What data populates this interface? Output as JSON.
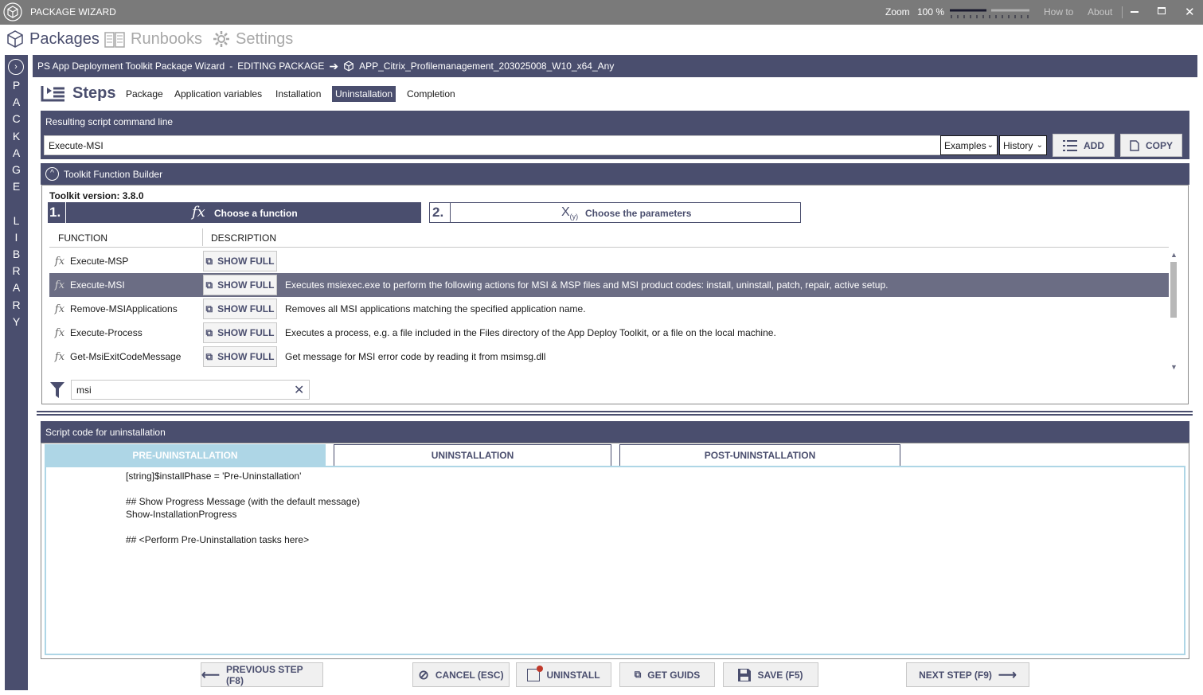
{
  "titlebar": {
    "app_title": "PACKAGE WIZARD",
    "zoom_label": "Zoom",
    "zoom_value": "100 %",
    "how_to": "How to",
    "about": "About"
  },
  "nav": {
    "packages": "Packages",
    "runbooks": "Runbooks",
    "settings": "Settings"
  },
  "sidebar": {
    "letters": [
      "P",
      "A",
      "C",
      "K",
      "A",
      "G",
      "E",
      "",
      "L",
      "I",
      "B",
      "R",
      "A",
      "R",
      "Y"
    ]
  },
  "header": {
    "wizard_title": "PS App Deployment Toolkit Package Wizard",
    "separator": "-",
    "editing_label": "EDITING PACKAGE",
    "package_name": "APP_Citrix_Profilemanagement_203025008_W10_x64_Any"
  },
  "steps": {
    "title": "Steps",
    "tabs": [
      {
        "label": "Package"
      },
      {
        "label": "Application variables"
      },
      {
        "label": "Installation"
      },
      {
        "label": "Uninstallation"
      },
      {
        "label": "Completion"
      }
    ],
    "active_tab": "Uninstallation"
  },
  "command": {
    "section_title": "Resulting script command line",
    "value": "Execute-MSI",
    "examples": "Examples",
    "history": "History",
    "add": "ADD",
    "copy": "COPY"
  },
  "builder": {
    "title": "Toolkit Function Builder",
    "toolkit_version_label": "Toolkit version:",
    "toolkit_version": "3.8.0",
    "step1_num": "1.",
    "step1_label": "Choose a function",
    "step2_num": "2.",
    "step2_label": "Choose the parameters",
    "col_function": "FUNCTION",
    "col_description": "DESCRIPTION",
    "show_full": "SHOW FULL",
    "functions": [
      {
        "name": "Execute-MSP",
        "description": ""
      },
      {
        "name": "Execute-MSI",
        "description": "Executes msiexec.exe to perform the following actions for MSI & MSP files and MSI product codes: install, uninstall, patch, repair, active setup."
      },
      {
        "name": "Remove-MSIApplications",
        "description": "Removes all MSI applications matching the specified application name."
      },
      {
        "name": "Execute-Process",
        "description": "Executes a process, e.g. a file included in the Files directory of the App Deploy Toolkit, or a file on the local machine."
      },
      {
        "name": "Get-MsiExitCodeMessage",
        "description": "Get message for MSI error code by reading it from msimsg.dll"
      }
    ],
    "selected_function": "Execute-MSI",
    "filter_value": "msi"
  },
  "script": {
    "section_title": "Script code for uninstallation",
    "tabs": [
      {
        "label": "PRE-UNINSTALLATION"
      },
      {
        "label": "UNINSTALLATION"
      },
      {
        "label": "POST-UNINSTALLATION"
      }
    ],
    "active_tab": "PRE-UNINSTALLATION",
    "lines": [
      "[string]$installPhase = 'Pre-Uninstallation'",
      "",
      "## Show Progress Message (with the default message)",
      "Show-InstallationProgress",
      "",
      "## <Perform Pre-Uninstallation tasks here>"
    ]
  },
  "footer": {
    "previous": "PREVIOUS STEP (F8)",
    "cancel": "CANCEL (ESC)",
    "uninstall": "UNINSTALL",
    "get_guids": "GET GUIDS",
    "save": "SAVE (F5)",
    "next": "NEXT STEP (F9)"
  },
  "colors": {
    "accent": "#4a4e6e",
    "selected_row": "#6b6d84",
    "code_tab_active": "#aed6e6",
    "titlebar": "#7a7a7a"
  }
}
